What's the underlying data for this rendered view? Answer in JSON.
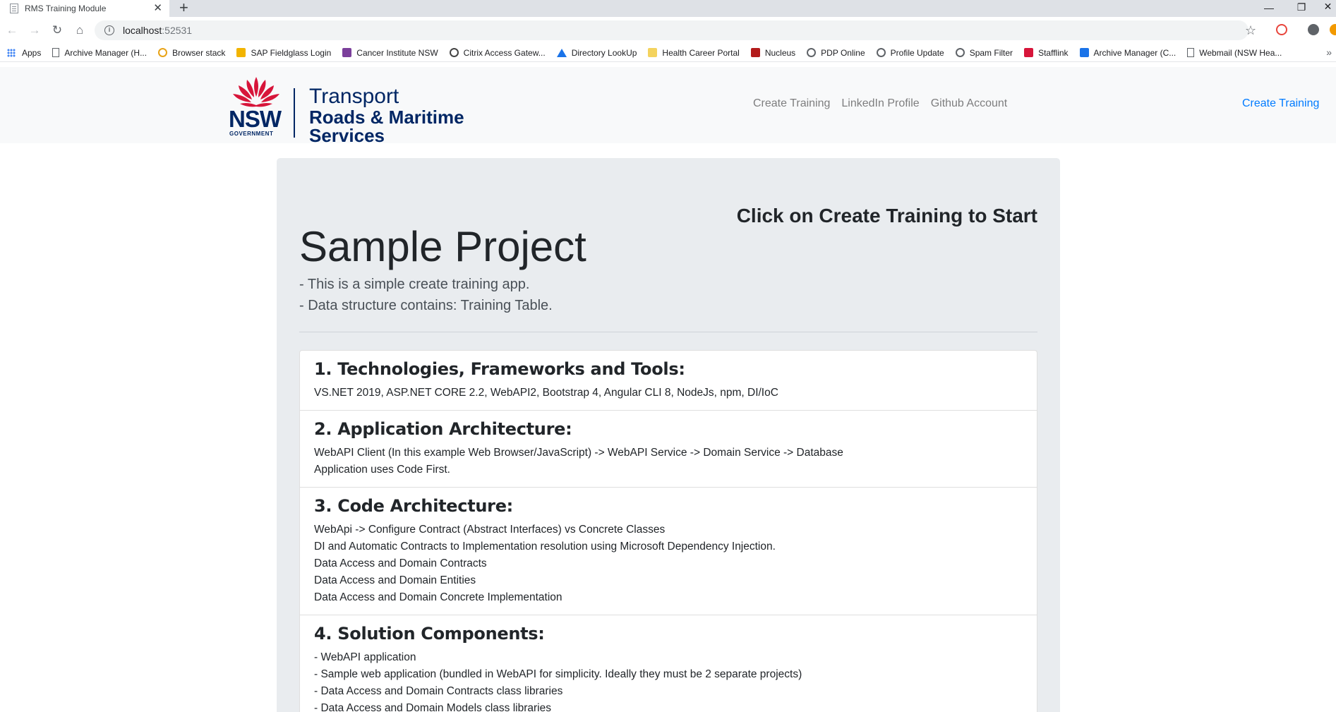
{
  "browser": {
    "tab_title": "RMS Training Module",
    "tab_close": "✕",
    "new_tab": "+",
    "url_host": "localhost",
    "url_port": ":52531",
    "bookmarks": [
      {
        "label": "Apps",
        "icon": "apps-grid-icon",
        "color": "#4285f4"
      },
      {
        "label": "Archive Manager (H...",
        "icon": "page-icon",
        "color": "#5f6368"
      },
      {
        "label": "Browser stack",
        "icon": "browserstack-icon",
        "color": "#e8a317"
      },
      {
        "label": "SAP Fieldglass Login",
        "icon": "fieldglass-icon",
        "color": "#f2b400"
      },
      {
        "label": "Cancer Institute NSW",
        "icon": "cancer-institute-icon",
        "color": "#7b3f9b"
      },
      {
        "label": "Citrix Access Gatew...",
        "icon": "citrix-icon",
        "color": "#444444"
      },
      {
        "label": "Directory LookUp",
        "icon": "directory-icon",
        "color": "#1a73e8"
      },
      {
        "label": "Health Career Portal",
        "icon": "folder-icon",
        "color": "#f4d35e"
      },
      {
        "label": "Nucleus",
        "icon": "nucleus-icon",
        "color": "#b31b1b"
      },
      {
        "label": "PDP Online",
        "icon": "globe-icon",
        "color": "#5f6368"
      },
      {
        "label": "Profile Update",
        "icon": "globe-icon",
        "color": "#5f6368"
      },
      {
        "label": "Spam Filter",
        "icon": "globe-icon",
        "color": "#5f6368"
      },
      {
        "label": "Stafflink",
        "icon": "waratah-icon",
        "color": "#d7153a"
      },
      {
        "label": "Archive Manager (C...",
        "icon": "archive-icon",
        "color": "#1a73e8"
      },
      {
        "label": "Webmail (NSW Hea...",
        "icon": "page-icon",
        "color": "#5f6368"
      }
    ]
  },
  "header": {
    "logo": {
      "nsw": "NSW",
      "government": "GOVERNMENT",
      "transport": "Transport",
      "rms_line1": "Roads & Maritime",
      "rms_line2": "Services"
    },
    "nav": [
      "Create Training",
      "LinkedIn Profile",
      "Github Account"
    ],
    "nav_right": "Create Training",
    "brand_color": "#002664",
    "waratah_color": "#d7153a",
    "link_color": "#007bff"
  },
  "main": {
    "cta": "Click on Create Training to Start",
    "title": "Sample Project",
    "leads": [
      "- This is a simple create training app.",
      "- Data structure contains: Training Table."
    ],
    "sections": [
      {
        "heading": "1. Technologies, Frameworks and Tools:",
        "lines": [
          "VS.NET 2019, ASP.NET CORE 2.2, WebAPI2, Bootstrap 4, Angular CLI 8, NodeJs, npm, DI/IoC"
        ]
      },
      {
        "heading": "2. Application Architecture:",
        "lines": [
          "WebAPI Client (In this example Web Browser/JavaScript) -> WebAPI Service -> Domain Service -> Database",
          "Application uses Code First."
        ]
      },
      {
        "heading": "3. Code Architecture:",
        "lines": [
          "WebApi -> Configure Contract (Abstract Interfaces) vs Concrete Classes",
          "DI and Automatic Contracts to Implementation resolution using Microsoft Dependency Injection.",
          "Data Access and Domain Contracts",
          "Data Access and Domain Entities",
          "Data Access and Domain Concrete Implementation"
        ]
      },
      {
        "heading": "4. Solution Components:",
        "lines": [
          "- WebAPI application",
          "- Sample web application (bundled in WebAPI for simplicity. Ideally they must be 2 separate projects)",
          "- Data Access and Domain Contracts class libraries",
          "- Data Access and Domain Models class libraries"
        ]
      }
    ]
  }
}
